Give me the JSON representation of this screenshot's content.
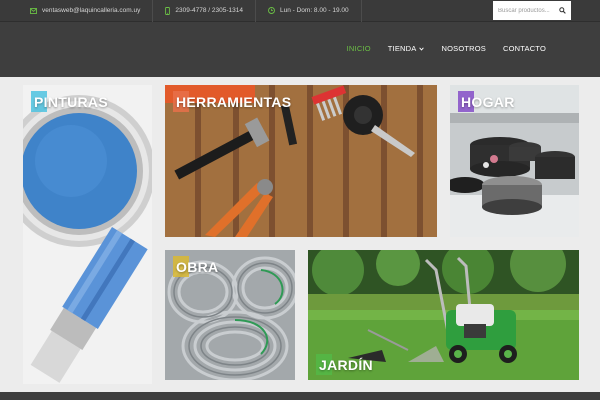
{
  "topbar": {
    "email": "ventasweb@laquincalleria.com.uy",
    "phone": "2309-4778 / 2305-1314",
    "hours": "Lun - Dom: 8.00 - 19.00",
    "search_placeholder": "Buscar productos..."
  },
  "nav": {
    "items": [
      {
        "label": "INICIO",
        "active": true
      },
      {
        "label": "TIENDA",
        "has_dropdown": true
      },
      {
        "label": "NOSOTROS"
      },
      {
        "label": "CONTACTO"
      }
    ]
  },
  "categories": [
    {
      "label": "PINTURAS",
      "accent": "#4fc3e0"
    },
    {
      "label": "HERRAMIENTAS",
      "accent": "#e8704a"
    },
    {
      "label": "HOGAR",
      "accent": "#8a55c9"
    },
    {
      "label": "OBRA",
      "accent": "#d9b833"
    },
    {
      "label": "JARDÍN",
      "accent": "#54b847"
    }
  ],
  "colors": {
    "accent_green": "#6bbf45",
    "topbar_bg": "#3a3a3a",
    "header_bg": "#3e3e3e"
  },
  "icons": [
    "envelope-icon",
    "mobile-phone-icon",
    "clock-icon",
    "search-icon",
    "chevron-down-icon"
  ]
}
